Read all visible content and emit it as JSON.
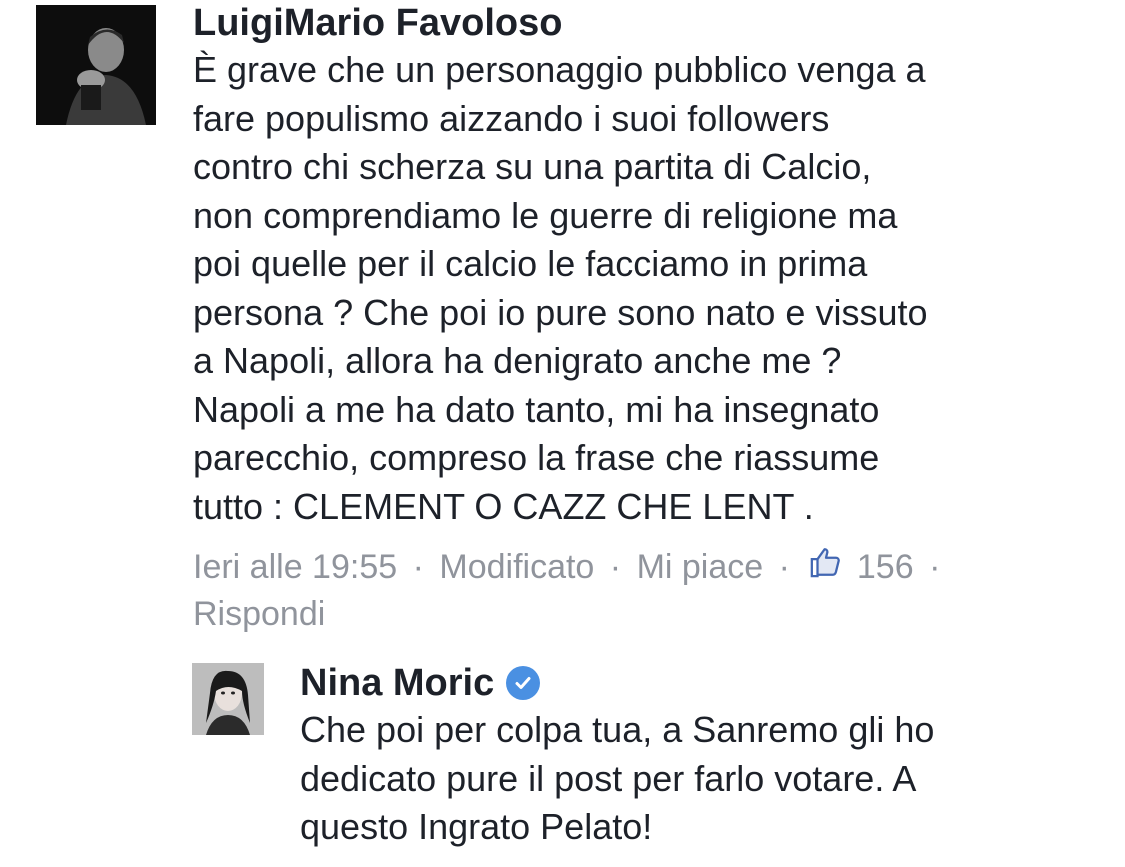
{
  "comment_main": {
    "author": "LuigiMario Favoloso",
    "text": "È grave che un personaggio pubblico venga a\nfare populismo aizzando i suoi followers\ncontro chi scherza su una partita di Calcio,\nnon comprendiamo le guerre di religione ma\npoi quelle per il calcio le facciamo in prima\npersona ? Che poi io pure sono nato e vissuto\na Napoli, allora ha denigrato anche me ?\nNapoli a me ha dato tanto, mi ha insegnato\nparecchio, compreso la frase che riassume\ntutto : CLEMENT O CAZZ CHE LENT .",
    "timestamp": "Ieri alle 19:55",
    "edited_label": "Modificato",
    "like_label": "Mi piace",
    "like_count": "156",
    "reply_label": "Rispondi",
    "separator": "·"
  },
  "comment_reply": {
    "author": "Nina Moric",
    "text": "Che poi per colpa tua, a Sanremo gli ho\ndedicato pure il post per farlo votare. A\nquesto Ingrato Pelato!"
  },
  "colors": {
    "text": "#1d2129",
    "meta": "#90949c",
    "verified": "#4a90e2",
    "like_icon": "#4267b2"
  }
}
